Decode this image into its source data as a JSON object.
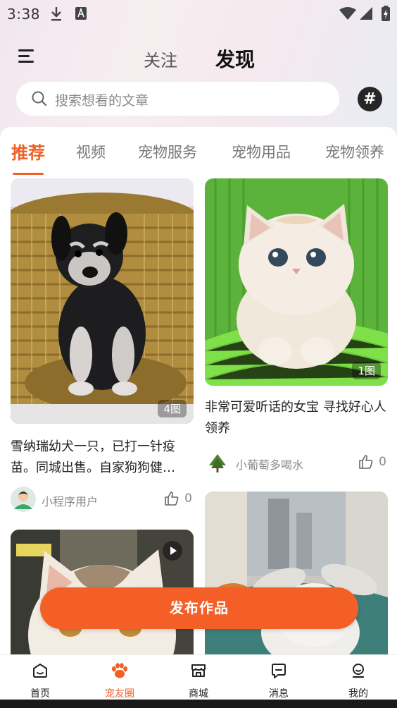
{
  "status_bar": {
    "time": "3:38"
  },
  "header": {
    "tab_follow": "关注",
    "tab_discover": "发现"
  },
  "search": {
    "placeholder": "搜索想看的文章"
  },
  "category_tabs": [
    "推荐",
    "视频",
    "宠物服务",
    "宠物用品",
    "宠物领养"
  ],
  "posts": [
    {
      "image_count": "4图",
      "title": "雪纳瑞幼犬一只，已打一针疫苗。同城出售。自家狗狗健…",
      "author": "小程序用户",
      "likes": "0"
    },
    {
      "image_count": "1图",
      "title": "非常可爱听话的女宝 寻找好心人领养",
      "author": "小葡萄多喝水",
      "likes": "0"
    }
  ],
  "publish_button": "发布作品",
  "bottom_nav": [
    {
      "label": "首页",
      "icon": "home-icon"
    },
    {
      "label": "宠友圈",
      "icon": "paw-icon"
    },
    {
      "label": "商城",
      "icon": "store-icon"
    },
    {
      "label": "消息",
      "icon": "message-icon"
    },
    {
      "label": "我的",
      "icon": "profile-icon"
    }
  ],
  "colors": {
    "accent": "#f06027",
    "publish": "#f45f27"
  }
}
